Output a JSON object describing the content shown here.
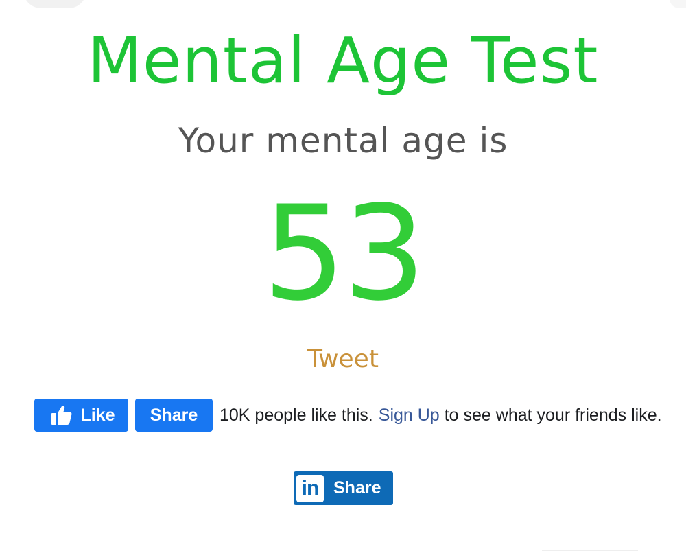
{
  "header": {
    "title": "Mental Age Test"
  },
  "result": {
    "subtitle": "Your mental age is",
    "age": "53"
  },
  "tweet": {
    "label": "Tweet"
  },
  "facebook": {
    "like_label": "Like",
    "share_label": "Share",
    "count_text": "10K people like this.",
    "signup_label": "Sign Up",
    "suffix_text": "to see what your friends like."
  },
  "linkedin": {
    "logo_text": "in",
    "share_label": "Share"
  },
  "icons": {
    "like": "thumbs-up-icon",
    "linkedin": "linkedin-logo-icon"
  },
  "colors": {
    "title": "#1dc436",
    "age": "#32cd38",
    "subtitle": "#555555",
    "tweet": "#c99139",
    "facebook": "#1877f2",
    "facebook_link": "#385898",
    "linkedin": "#0e6ab6"
  }
}
